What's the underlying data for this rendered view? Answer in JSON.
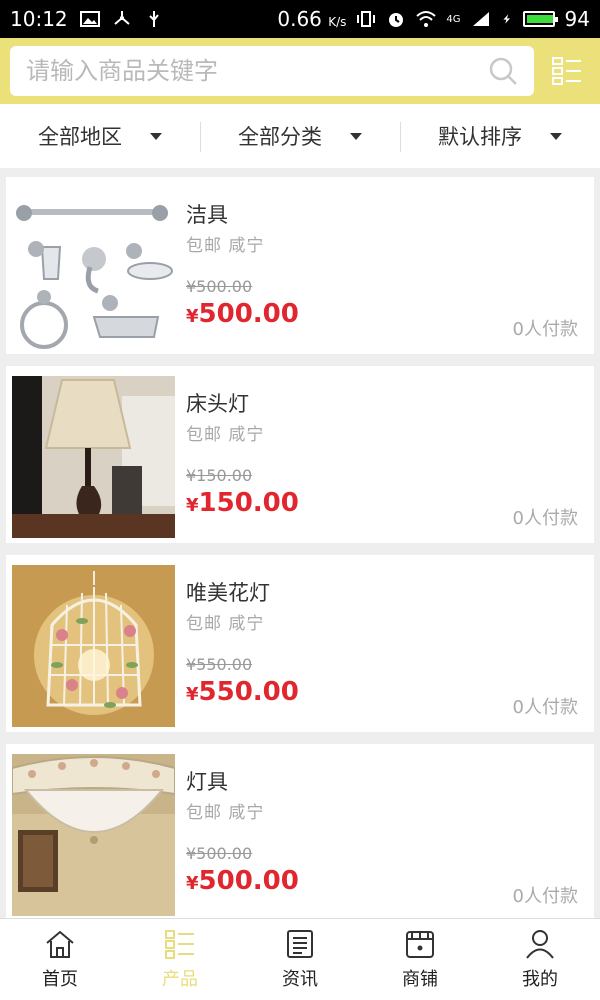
{
  "status_bar": {
    "time": "10:12",
    "speed": "0.66",
    "speed_unit": "K/s",
    "network": "4G",
    "battery": "94",
    "battery_level": 0.94
  },
  "search": {
    "placeholder": "请输入商品关键字",
    "value": ""
  },
  "filters": [
    {
      "label": "全部地区"
    },
    {
      "label": "全部分类"
    },
    {
      "label": "默认排序"
    }
  ],
  "products": [
    {
      "title": "洁具",
      "shipping": "包邮",
      "city": "咸宁",
      "currency": "¥",
      "old_price": "¥500.00",
      "price": "500.00",
      "paid": "0人付款",
      "image_icon": "bathroom-fixtures-image"
    },
    {
      "title": "床头灯",
      "shipping": "包邮",
      "city": "咸宁",
      "currency": "¥",
      "old_price": "¥150.00",
      "price": "150.00",
      "paid": "0人付款",
      "image_icon": "bedside-lamp-image"
    },
    {
      "title": "唯美花灯",
      "shipping": "包邮",
      "city": "咸宁",
      "currency": "¥",
      "old_price": "¥550.00",
      "price": "550.00",
      "paid": "0人付款",
      "image_icon": "flower-lamp-image"
    },
    {
      "title": "灯具",
      "shipping": "包邮",
      "city": "咸宁",
      "currency": "¥",
      "old_price": "¥500.00",
      "price": "500.00",
      "paid": "0人付款",
      "image_icon": "ceiling-lamp-image"
    }
  ],
  "bottom_nav": [
    {
      "label": "首页",
      "icon": "home-icon",
      "active": false
    },
    {
      "label": "产品",
      "icon": "products-grid-icon",
      "active": true
    },
    {
      "label": "资讯",
      "icon": "news-icon",
      "active": false
    },
    {
      "label": "商铺",
      "icon": "shop-icon",
      "active": false
    },
    {
      "label": "我的",
      "icon": "user-icon",
      "active": false
    }
  ],
  "colors": {
    "header": "#ebe07a",
    "price": "#e0262e",
    "active_tab": "#e9dc7c"
  }
}
